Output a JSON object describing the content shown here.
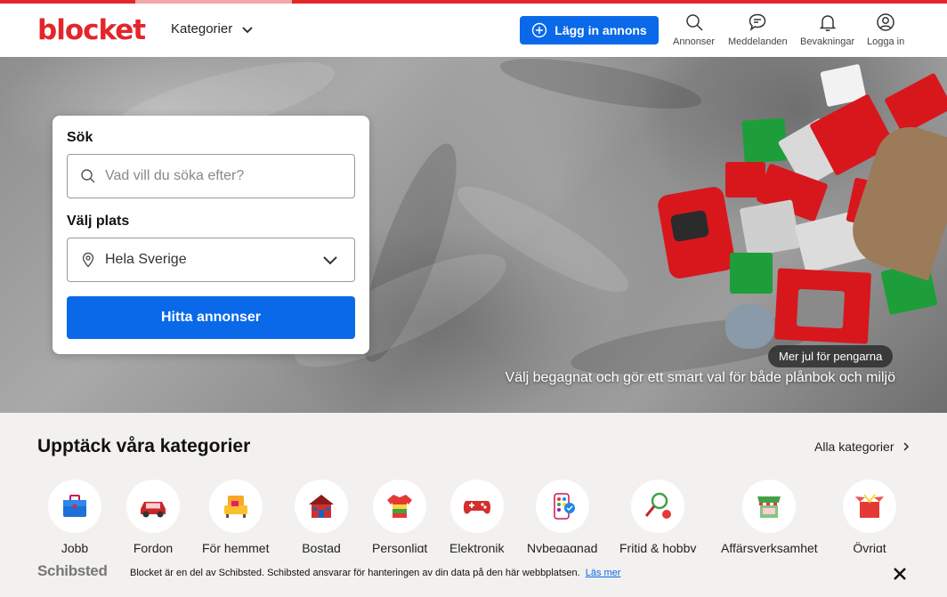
{
  "brand": {
    "logo": "blocket",
    "accent": "#e3262b",
    "primary": "#0a69e8"
  },
  "header": {
    "categories_label": "Kategorier",
    "post_ad_label": "Lägg in annons",
    "nav": [
      {
        "label": "Annonser",
        "icon": "search-icon"
      },
      {
        "label": "Meddelanden",
        "icon": "chat-icon"
      },
      {
        "label": "Bevakningar",
        "icon": "bell-icon"
      },
      {
        "label": "Logga in",
        "icon": "user-icon"
      }
    ]
  },
  "search": {
    "title": "Sök",
    "placeholder": "Vad vill du söka efter?",
    "location_label": "Välj plats",
    "location_value": "Hela Sverige",
    "button": "Hitta annonser"
  },
  "hero": {
    "tag": "Mer jul för pengarna",
    "tagline": "Välj begagnat och gör ett smart val för både plånbok och miljö"
  },
  "categories": {
    "title": "Upptäck våra kategorier",
    "all_label": "Alla kategorier",
    "items": [
      {
        "label": "Jobb",
        "icon": "briefcase-icon"
      },
      {
        "label": "Fordon",
        "icon": "car-icon"
      },
      {
        "label": "För hemmet",
        "icon": "armchair-icon"
      },
      {
        "label": "Bostad",
        "icon": "house-icon"
      },
      {
        "label": "Personligt",
        "icon": "shirt-icon"
      },
      {
        "label": "Elektronik",
        "icon": "gamepad-icon"
      },
      {
        "label": "Nybegagnad",
        "icon": "palette-icon"
      },
      {
        "label": "Fritid & hobby",
        "icon": "tennis-icon"
      },
      {
        "label": "Affärsverksamhet",
        "icon": "shop-icon"
      },
      {
        "label": "Övrigt",
        "icon": "box-icon"
      }
    ]
  },
  "consent": {
    "brand": "Schibsted",
    "text": "Blocket är en del av Schibsted. Schibsted ansvarar för hanteringen av din data på den här webbplatsen.",
    "link": "Läs mer"
  }
}
